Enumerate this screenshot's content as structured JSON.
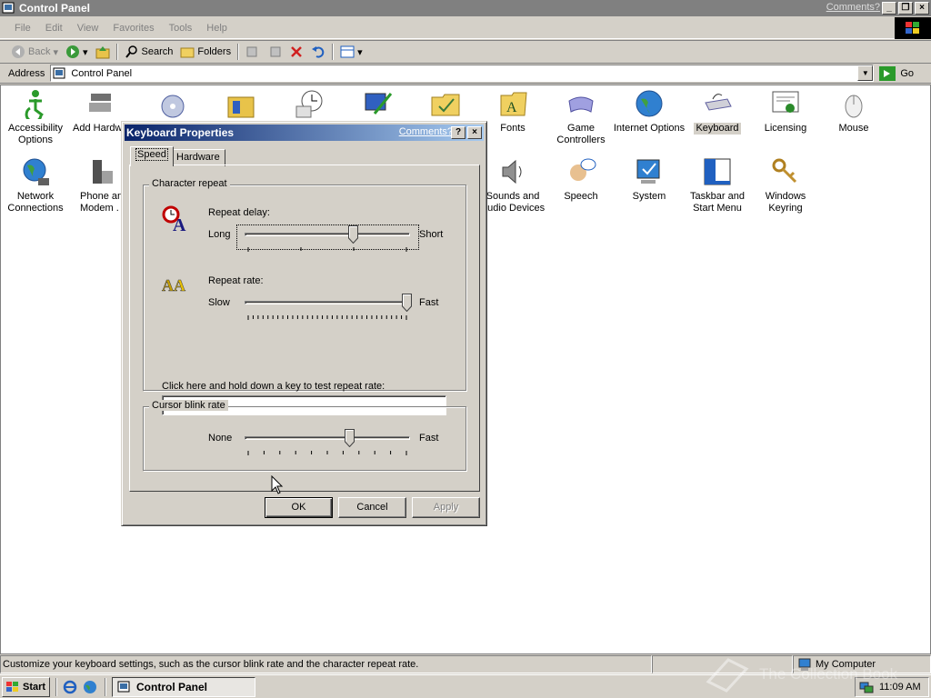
{
  "window": {
    "title": "Control Panel",
    "comments": "Comments?"
  },
  "menu": [
    "File",
    "Edit",
    "View",
    "Favorites",
    "Tools",
    "Help"
  ],
  "toolbar": {
    "back": "Back",
    "search": "Search",
    "folders": "Folders"
  },
  "address": {
    "label": "Address",
    "value": "Control Panel",
    "go": "Go"
  },
  "items": {
    "accessibility": "Accessibility Options",
    "add_hardware": "Add Hardw",
    "fonts": "Fonts",
    "game_controllers": "Game Controllers",
    "internet_options": "Internet Options",
    "keyboard": "Keyboard",
    "licensing": "Licensing",
    "mouse": "Mouse",
    "network": "Network Connections",
    "phone": "Phone an Modem .",
    "sounds": "Sounds and Audio Devices",
    "speech": "Speech",
    "system": "System",
    "taskbar": "Taskbar and Start Menu",
    "keyring": "Windows Keyring"
  },
  "dialog": {
    "title": "Keyboard Properties",
    "comments": "Comments?",
    "tabs": [
      "Speed",
      "Hardware"
    ],
    "char_repeat": {
      "legend": "Character repeat",
      "delay_label": "Repeat delay:",
      "delay_long": "Long",
      "delay_short": "Short",
      "delay_value": 0.66,
      "rate_label": "Repeat rate:",
      "rate_slow": "Slow",
      "rate_fast": "Fast",
      "rate_value": 1.0,
      "test_label": "Click here and hold down a key to test repeat rate:",
      "test_value": ""
    },
    "cursor_blink": {
      "legend": "Cursor blink rate",
      "none": "None",
      "fast": "Fast",
      "value": 0.64
    },
    "buttons": {
      "ok": "OK",
      "cancel": "Cancel",
      "apply": "Apply"
    }
  },
  "status": {
    "text": "Customize your keyboard settings, such as the cursor blink rate and the character repeat rate.",
    "zone": "My Computer"
  },
  "taskbar": {
    "start": "Start",
    "task": "Control Panel",
    "clock": "11:09 AM"
  },
  "watermark": "The Collection Book",
  "colors": {
    "titlebar_active": "#0a246a",
    "titlebar_inactive": "#808080",
    "face": "#d4d0c8"
  }
}
